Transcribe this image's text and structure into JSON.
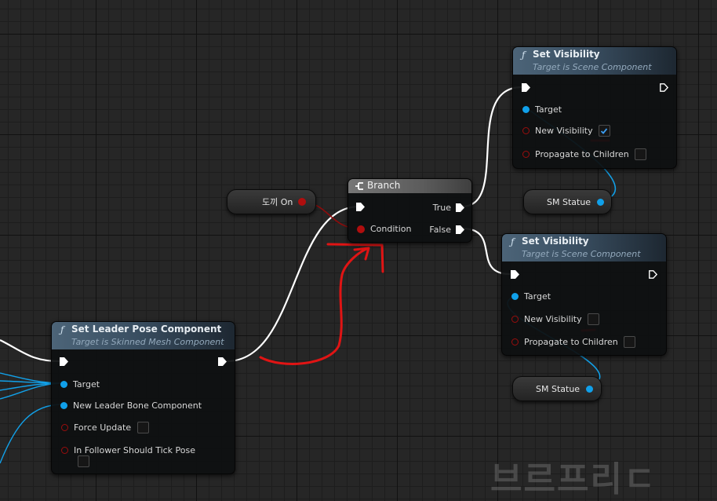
{
  "nodes": {
    "set_leader_pose": {
      "title": "Set Leader Pose Component",
      "subtitle": "Target is Skinned Mesh Component",
      "pins": {
        "target": "Target",
        "new_leader_bone": "New Leader Bone Component",
        "force_update": "Force Update",
        "follower_tick": "In Follower Should Tick Pose"
      }
    },
    "branch": {
      "title": "Branch",
      "condition": "Condition",
      "true_label": "True",
      "false_label": "False"
    },
    "set_visibility_top": {
      "title": "Set Visibility",
      "subtitle": "Target is Scene Component",
      "target": "Target",
      "new_visibility": "New Visibility",
      "propagate": "Propagate to Children",
      "new_visibility_checked": true
    },
    "set_visibility_bottom": {
      "title": "Set Visibility",
      "subtitle": "Target is Scene Component",
      "target": "Target",
      "new_visibility": "New Visibility",
      "propagate": "Propagate to Children",
      "new_visibility_checked": false
    },
    "var_toggle": {
      "label": "도끼 On"
    },
    "var_statue_top": {
      "label": "SM Statue"
    },
    "var_statue_bottom": {
      "label": "SM Statue"
    }
  },
  "watermark": "브르프리ㄷ",
  "colors": {
    "exec_wire": "#ffffff",
    "object_pin": "#10a0ea",
    "bool_pin": "#9a0d0d",
    "annotation": "#e01414"
  }
}
